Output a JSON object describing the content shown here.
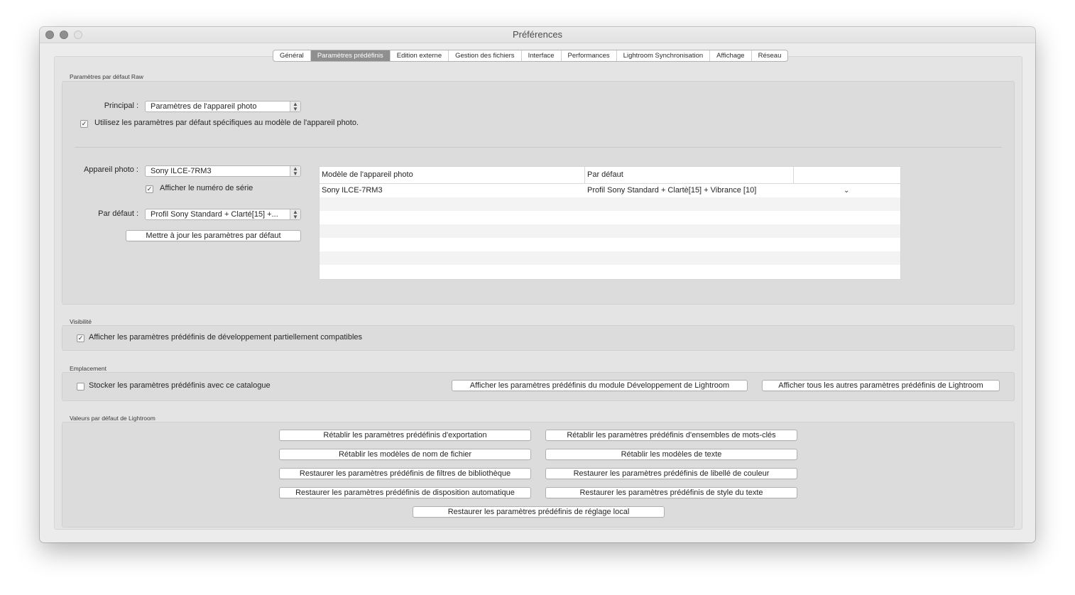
{
  "window": {
    "title": "Préférences"
  },
  "tabs": [
    {
      "label": "Général",
      "active": false
    },
    {
      "label": "Paramètres prédéfinis",
      "active": true
    },
    {
      "label": "Edition externe",
      "active": false
    },
    {
      "label": "Gestion des fichiers",
      "active": false
    },
    {
      "label": "Interface",
      "active": false
    },
    {
      "label": "Performances",
      "active": false
    },
    {
      "label": "Lightroom Synchronisation",
      "active": false
    },
    {
      "label": "Affichage",
      "active": false
    },
    {
      "label": "Réseau",
      "active": false
    }
  ],
  "raw_defaults": {
    "section_label": "Paramètres par défaut Raw",
    "principal_label": "Principal :",
    "principal_value": "Paramètres de l'appareil photo",
    "camera_specific_label": "Utilisez les paramètres par défaut spécifiques au modèle de l'appareil photo.",
    "camera_specific_checked": true,
    "camera_label": "Appareil photo :",
    "camera_value": "Sony ILCE-7RM3",
    "show_serial_label": "Afficher le numéro de série",
    "show_serial_checked": true,
    "default_label": "Par défaut :",
    "default_value": "Profil Sony Standard + Clarté[15] +...",
    "update_button": "Mettre à jour les paramètres par défaut",
    "table": {
      "headers": [
        "Modèle de l'appareil photo",
        "Par défaut"
      ],
      "rows": [
        {
          "model": "Sony ILCE-7RM3",
          "default": "Profil Sony Standard + Clartè[15] + Vibrance [10]"
        }
      ]
    }
  },
  "visibility": {
    "section_label": "Visibilité",
    "partial_compat_label": "Afficher les paramètres prédéfinis de développement partiellement compatibles",
    "partial_compat_checked": true
  },
  "location": {
    "section_label": "Emplacement",
    "store_with_catalog_label": "Stocker les paramètres prédéfinis avec ce catalogue",
    "store_with_catalog_checked": false,
    "show_develop_button": "Afficher les paramètres prédéfinis du module Développement de Lightroom",
    "show_all_button": "Afficher tous les autres paramètres prédéfinis de Lightroom"
  },
  "lightroom_defaults": {
    "section_label": "Valeurs par défaut de Lightroom",
    "buttons": [
      "Rétablir les paramètres prédéfinis d'exportation",
      "Rétablir les paramètres prédéfinis d'ensembles de mots-clés",
      "Rétablir les modèles de nom de fichier",
      "Rétablir les modèles de texte",
      "Restaurer les paramètres prédéfinis de filtres de bibliothèque",
      "Restaurer les paramètres prédéfinis de libellé de couleur",
      "Restaurer les paramètres prédéfinis de disposition automatique",
      "Restaurer les paramètres prédéfinis de style du texte",
      "Restaurer les paramètres prédéfinis de réglage local"
    ]
  }
}
